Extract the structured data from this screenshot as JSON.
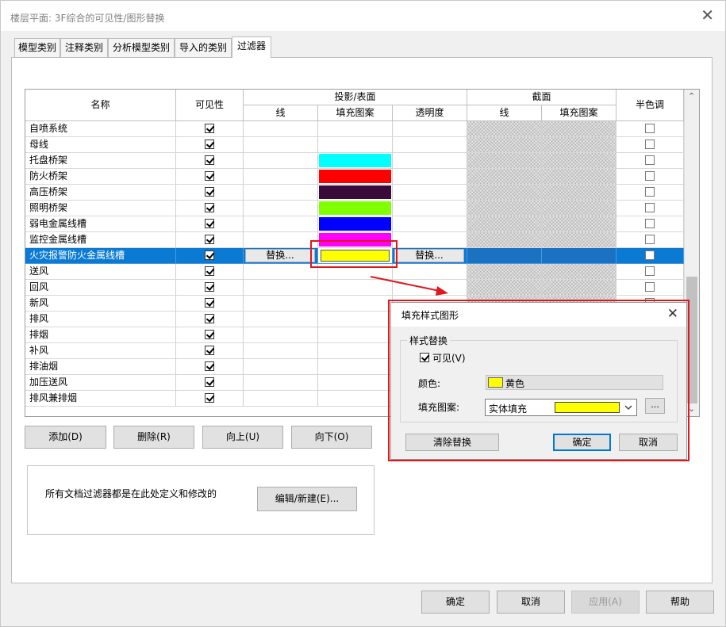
{
  "window": {
    "title": "楼层平面: 3F综合的可见性/图形替换",
    "close_glyph": "✕"
  },
  "tabs": [
    "模型类别",
    "注释类别",
    "分析模型类别",
    "导入的类别",
    "过滤器"
  ],
  "active_tab": "过滤器",
  "table": {
    "headers": {
      "name": "名称",
      "visibility": "可见性",
      "projection": "投影/表面",
      "proj_line": "线",
      "proj_fill": "填充图案",
      "proj_transparency": "透明度",
      "cut": "截面",
      "cut_line": "线",
      "cut_fill": "填充图案",
      "halftone": "半色调"
    },
    "rows": [
      {
        "name": "自喷系统",
        "visible": true,
        "fill_color": null
      },
      {
        "name": "母线",
        "visible": true,
        "fill_color": null
      },
      {
        "name": "托盘桥架",
        "visible": true,
        "fill_color": "#00ffff"
      },
      {
        "name": "防火桥架",
        "visible": true,
        "fill_color": "#ff0000"
      },
      {
        "name": "高压桥架",
        "visible": true,
        "fill_color": "#3a0a3a"
      },
      {
        "name": "照明桥架",
        "visible": true,
        "fill_color": "#80ff00"
      },
      {
        "name": "弱电金属线槽",
        "visible": true,
        "fill_color": "#0000ff"
      },
      {
        "name": "监控金属线槽",
        "visible": true,
        "fill_color": "#ff00ff"
      },
      {
        "name": "火灾报警防火金属线槽",
        "visible": true,
        "fill_color": "#ffff00",
        "selected": true
      },
      {
        "name": "送风",
        "visible": true,
        "fill_color": null
      },
      {
        "name": "回风",
        "visible": true,
        "fill_color": null
      },
      {
        "name": "新风",
        "visible": true,
        "fill_color": null
      },
      {
        "name": "排风",
        "visible": true,
        "fill_color": null
      },
      {
        "name": "排烟",
        "visible": true,
        "fill_color": null
      },
      {
        "name": "补风",
        "visible": true,
        "fill_color": null
      },
      {
        "name": "排油烟",
        "visible": true,
        "fill_color": null
      },
      {
        "name": "加压送风",
        "visible": true,
        "fill_color": null
      },
      {
        "name": "排风兼排烟",
        "visible": true,
        "fill_color": null
      }
    ],
    "override_label": "替换...",
    "scroll_up_glyph": "⌃",
    "scroll_down_glyph": "⌄"
  },
  "actions": {
    "add": "添加(D)",
    "delete": "删除(R)",
    "up": "向上(U)",
    "down": "向下(O)"
  },
  "info": {
    "text": "所有文档过滤器都是在此处定义和修改的",
    "edit_button": "编辑/新建(E)..."
  },
  "footer": {
    "ok": "确定",
    "cancel": "取消",
    "apply": "应用(A)",
    "help": "帮助"
  },
  "popup": {
    "title": "填充样式图形",
    "close_glyph": "✕",
    "group_title": "样式替换",
    "visible_label": "可见(V)",
    "visible_checked": true,
    "color_label": "颜色:",
    "color_name": "黄色",
    "color_value": "#ffff00",
    "pattern_label": "填充图案:",
    "pattern_value": "实体填充",
    "more_button": "...",
    "clear_button": "清除替换",
    "ok": "确定",
    "cancel": "取消"
  },
  "colors": {
    "accent": "#0078d7",
    "selection": "#0a7ad3",
    "highlight": "#e0161d"
  }
}
